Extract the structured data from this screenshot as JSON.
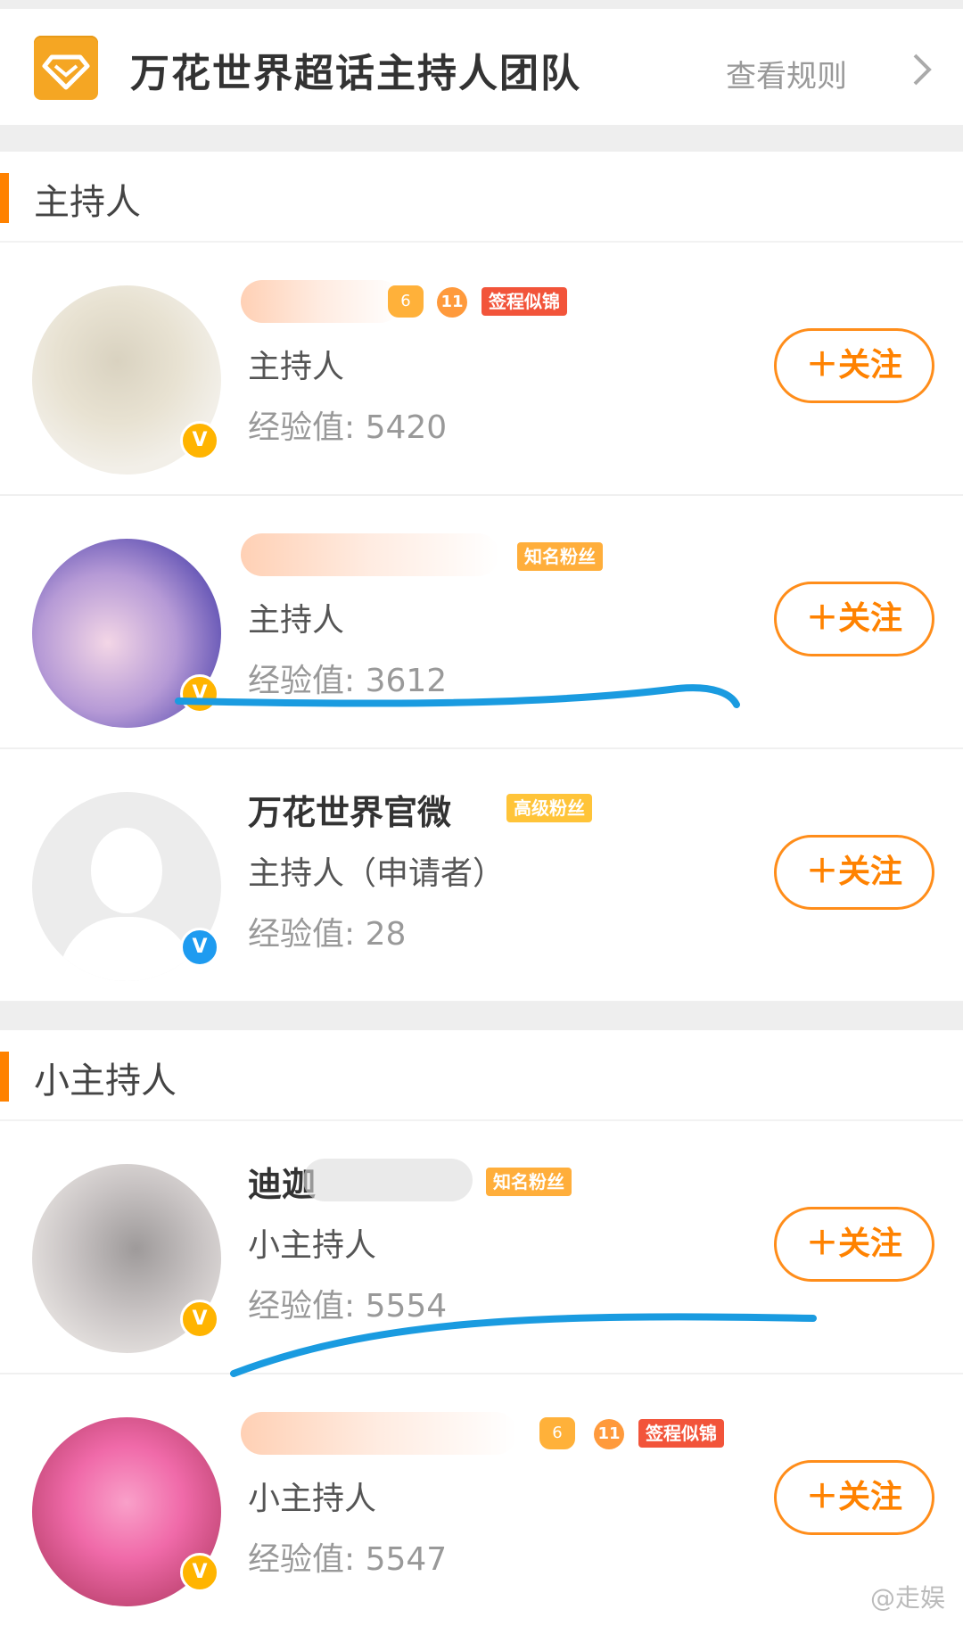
{
  "header": {
    "title": "万花世界超话主持人团队",
    "rules_label": "查看规则",
    "logo_icon": "diamond-icon",
    "chevron_icon": "chevron-right-icon"
  },
  "sections": [
    {
      "label": "主持人"
    },
    {
      "label": "小主持人"
    }
  ],
  "follow_label": "＋关注",
  "verified_mark": "V",
  "members": [
    {
      "name": "",
      "name_visible": false,
      "role": "主持人",
      "experience": "经验值: 5420",
      "badges": [
        {
          "type": "crown",
          "text": "6"
        },
        {
          "type": "gem",
          "text": "11"
        },
        {
          "type": "tag",
          "text": "签程似锦",
          "color": "#f2543a"
        }
      ],
      "verified": "gold"
    },
    {
      "name": "",
      "name_visible": false,
      "role": "主持人",
      "experience": "经验值: 3612",
      "badges": [
        {
          "type": "tag",
          "text": "知名粉丝",
          "color": "#ffae3b",
          "level": "10"
        }
      ],
      "verified": "gold"
    },
    {
      "name": "万花世界官微",
      "name_visible": true,
      "role": "主持人（申请者）",
      "experience": "经验值: 28",
      "badges": [
        {
          "type": "tag",
          "text": "高级粉丝",
          "color": "#ffc439",
          "level": "3"
        }
      ],
      "verified": "blue"
    },
    {
      "name": "迪迦",
      "name_visible": true,
      "role": "小主持人",
      "experience": "经验值: 5554",
      "badges": [
        {
          "type": "tag",
          "text": "知名粉丝",
          "color": "#ffae3b"
        }
      ],
      "verified": "gold"
    },
    {
      "name": "",
      "name_visible": false,
      "role": "小主持人",
      "experience": "经验值: 5547",
      "badges": [
        {
          "type": "crown",
          "text": "6"
        },
        {
          "type": "gem",
          "text": "11"
        },
        {
          "type": "tag",
          "text": "签程似锦",
          "color": "#f2543a"
        }
      ],
      "verified": "gold"
    }
  ],
  "watermark": "@走娱",
  "colors": {
    "accent": "#ff8200",
    "annotation_line": "#1a9be0",
    "verified_gold": "#ffb400",
    "verified_blue": "#1e9bf0"
  }
}
